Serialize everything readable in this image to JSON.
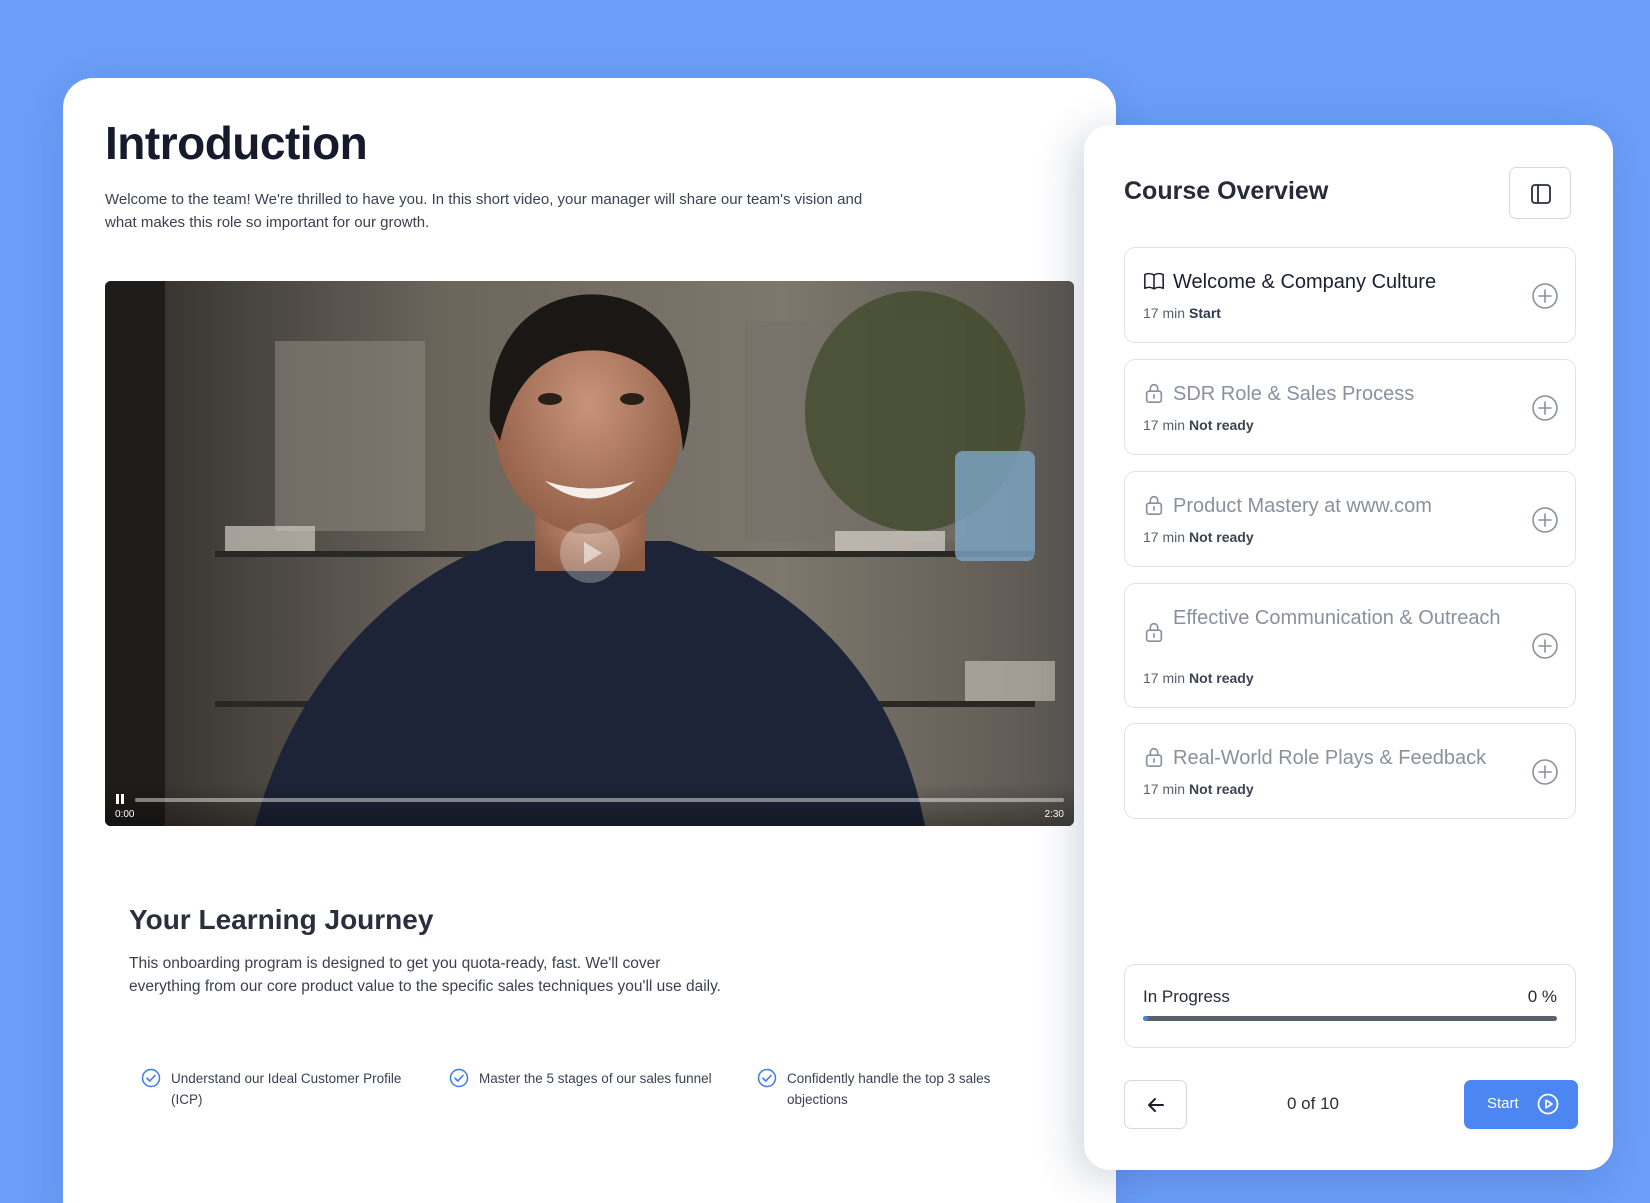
{
  "lesson": {
    "title": "Introduction",
    "intro": "Welcome to the team! We're thrilled to have you. In this short video, your manager will share our team's vision and what makes this role so important for our growth."
  },
  "video": {
    "current_time": "0:00",
    "duration": "2:30",
    "progress": 0,
    "state": "paused"
  },
  "journey": {
    "title": "Your Learning Journey",
    "description": "This onboarding program is designed to get you quota-ready, fast. We'll cover everything from our core product value to the specific sales techniques you'll use daily.",
    "objectives": [
      "Understand our Ideal Customer Profile (ICP)",
      "Master the 5 stages of our sales funnel",
      "Confidently handle the top 3 sales objections"
    ]
  },
  "panel": {
    "title": "Course Overview",
    "modules": [
      {
        "title": "Welcome & Company Culture",
        "duration": "17 min",
        "status": "Start",
        "locked": false
      },
      {
        "title": "SDR Role & Sales Process",
        "duration": "17 min",
        "status": "Not ready",
        "locked": true
      },
      {
        "title": "Product Mastery at www.com",
        "duration": "17 min",
        "status": "Not ready",
        "locked": true
      },
      {
        "title": "Effective Communication & Outreach",
        "duration": "17 min",
        "status": "Not ready",
        "locked": true
      },
      {
        "title": "Real-World Role Plays & Feedback",
        "duration": "17 min",
        "status": "Not ready",
        "locked": true
      }
    ],
    "progress": {
      "label": "In Progress",
      "value_text": "0 %",
      "value": 0
    },
    "footer": {
      "counter": "0 of 10",
      "start_label": "Start"
    }
  },
  "colors": {
    "background": "#6a9ef7",
    "accent": "#4c86f3",
    "text_dark": "#151a2d",
    "text_muted": "#8a909c"
  }
}
